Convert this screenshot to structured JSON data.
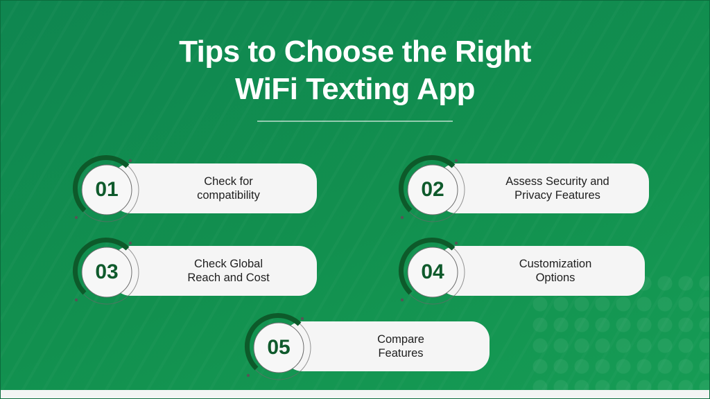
{
  "title": {
    "line1": "Tips to Choose the Right",
    "line2": "WiFi Texting App"
  },
  "colors": {
    "background": "#12904f",
    "card": "#f5f5f5",
    "badge_number": "#0f5a2c",
    "arc": "#0d5a2a",
    "title": "#ffffff"
  },
  "tips": [
    {
      "number": "01",
      "line1": "Check for",
      "line2": "compatibility"
    },
    {
      "number": "02",
      "line1": "Assess Security and",
      "line2": "Privacy Features"
    },
    {
      "number": "03",
      "line1": "Check Global",
      "line2": "Reach and Cost"
    },
    {
      "number": "04",
      "line1": "Customization",
      "line2": "Options"
    },
    {
      "number": "05",
      "line1": "Compare",
      "line2": "Features"
    }
  ]
}
